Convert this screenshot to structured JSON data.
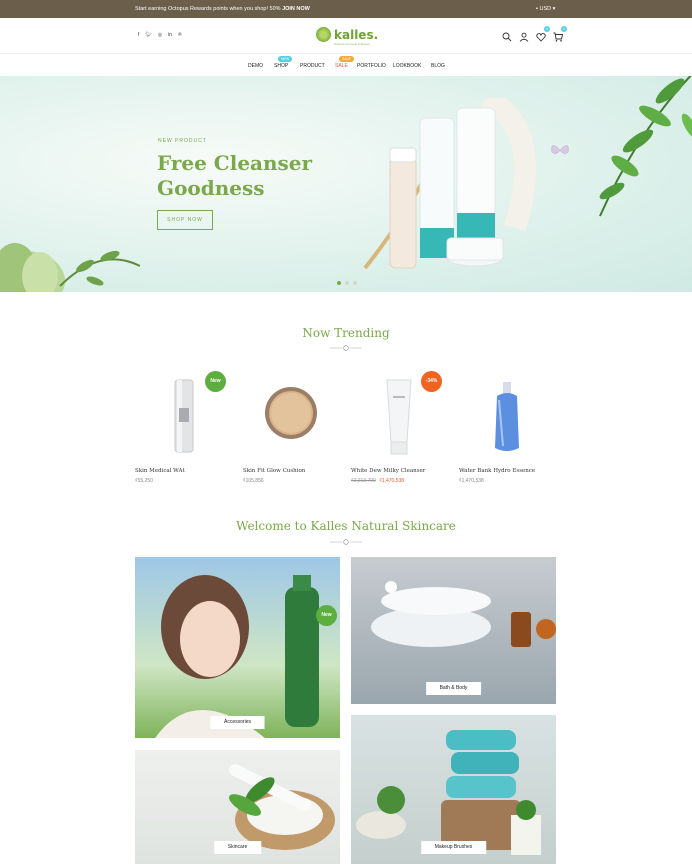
{
  "topbar": {
    "promo": "Start earning Octopus Rewards points when you shop! 50%",
    "promo_link": "JOIN NOW",
    "currency": "USD"
  },
  "header": {
    "logo_text": "kalles.",
    "logo_tagline": "Natural Cosmetic & Beauty",
    "socials": [
      "f",
      "t",
      "ig",
      "in",
      "p"
    ],
    "wishlist_count": "0",
    "cart_count": "0"
  },
  "nav": {
    "items": [
      {
        "label": "DEMO"
      },
      {
        "label": "SHOP",
        "badge": "New",
        "badge_color": "#56cfe1"
      },
      {
        "label": "PRODUCT"
      },
      {
        "label": "SALE",
        "badge": "Sale",
        "badge_color": "#f0a93a"
      },
      {
        "label": "PORTFOLIO"
      },
      {
        "label": "LOOKBOOK"
      },
      {
        "label": "BLOG"
      }
    ]
  },
  "hero": {
    "kicker": "NEW PRODUCT",
    "title": "Free Cleanser Goodness",
    "button": "SHOP NOW",
    "slide_count": 3,
    "active_slide": 1
  },
  "trending": {
    "title": "Now Trending",
    "products": [
      {
        "name": "Skin Medical WAt",
        "price": "₫55,250",
        "old_price": "",
        "badge": "New",
        "badge_color": "#5cae3f",
        "icon": "serum-tube"
      },
      {
        "name": "Skin Fit Glow Cushion",
        "price": "₫105,856",
        "old_price": "",
        "badge": "",
        "icon": "cushion-compact"
      },
      {
        "name": "White Dew Milky Cleanser",
        "price": "₫1,470,538",
        "old_price": "₫2,213,700",
        "badge": "-34%",
        "badge_color": "#f0641f",
        "icon": "cleanser-tube"
      },
      {
        "name": "Water Bank Hydro Essence",
        "price": "₫1,470,538",
        "old_price": "",
        "badge": "",
        "icon": "essence-bottle"
      }
    ]
  },
  "welcome": {
    "title": "Welcome to Kalles Natural Skincare",
    "categories": [
      {
        "label": "Accessories",
        "badge": "New"
      },
      {
        "label": "Bath & Body"
      },
      {
        "label": "Skincare"
      },
      {
        "label": "Makeup Brushes"
      }
    ]
  },
  "colors": {
    "brand_green": "#7aa84a",
    "topbar_bg": "#6b5e4a",
    "sale_red": "#e9573f"
  }
}
